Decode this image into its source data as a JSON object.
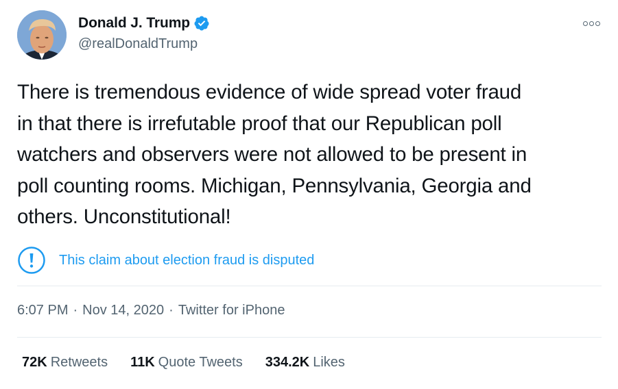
{
  "author": {
    "display_name": "Donald J. Trump",
    "handle": "@realDonaldTrump",
    "verified": true
  },
  "tweet": {
    "text": "There is tremendous evidence of wide spread voter fraud\nin that there is irrefutable proof that our Republican poll\nwatchers and observers were not allowed to be present in\npoll counting rooms. Michigan, Pennsylvania, Georgia and\nothers. Unconstitutional!"
  },
  "notice": {
    "icon": "exclamation-circle-icon",
    "text": "This claim about election fraud is disputed"
  },
  "meta": {
    "time": "6:07 PM",
    "separator": "·",
    "date": "Nov 14, 2020",
    "source": "Twitter for iPhone"
  },
  "stats": {
    "retweets": {
      "count": "72K",
      "label": "Retweets"
    },
    "quote_tweets": {
      "count": "11K",
      "label": "Quote Tweets"
    },
    "likes": {
      "count": "334.2K",
      "label": "Likes"
    }
  },
  "colors": {
    "accent": "#1d9bf0",
    "secondary_text": "#536471",
    "primary_text": "#0f1419",
    "divider": "#e6ecf0"
  }
}
